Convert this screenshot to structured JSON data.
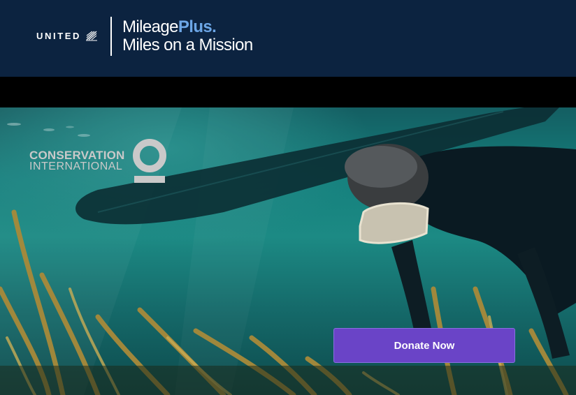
{
  "header": {
    "airline": "UNITED",
    "program_name": "Mileage",
    "program_plus": "Plus",
    "program_suffix": ".",
    "subtitle": "Miles on a Mission",
    "background_color": "#0c2340",
    "accent_color": "#6ca6e6"
  },
  "hero": {
    "partner_line1": "CONSERVATION",
    "partner_line2": "INTERNATIONAL",
    "image_description_icon": "underwater-snorkeler-photo",
    "donate_button_label": "Donate Now",
    "donate_button_color": "#6a44c7"
  }
}
